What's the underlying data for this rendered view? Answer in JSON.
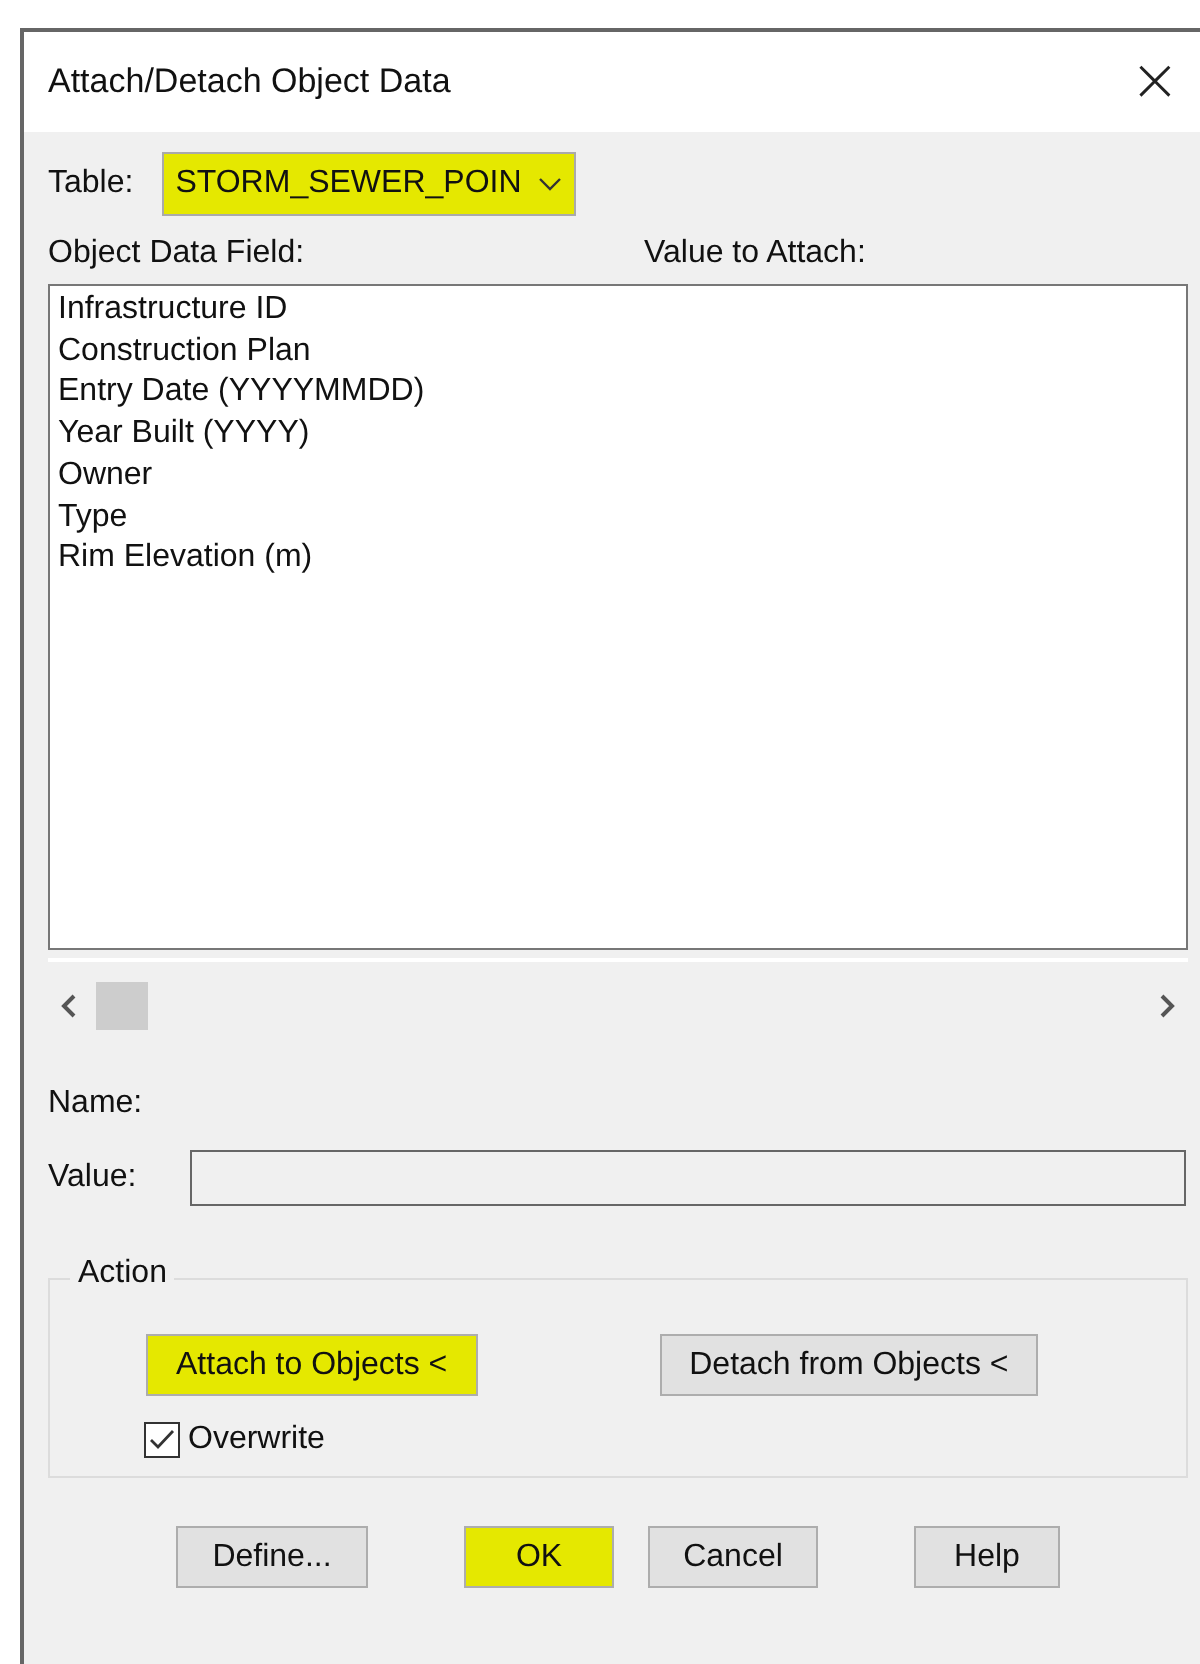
{
  "window": {
    "title": "Attach/Detach Object Data",
    "close": "×"
  },
  "table": {
    "label": "Table:",
    "value": "STORM_SEWER_POIN",
    "highlighted": true
  },
  "columns": [
    "Object Data Field:",
    "Value to Attach:"
  ],
  "fields": [
    "Infrastructure ID",
    "Construction Plan",
    "Entry Date (YYYYMMDD)",
    "Year Built (YYYY)",
    "Owner",
    "Type",
    "Rim Elevation (m)"
  ],
  "name_label": "Name:",
  "value_label": "Value:",
  "action": {
    "title": "Action",
    "buttons": [
      {
        "label": "Attach to Objects <",
        "highlighted": true
      },
      {
        "label": "Detach from Objects <",
        "highlighted": false
      }
    ],
    "overwrite": {
      "label": "Overwrite",
      "checked": true
    }
  },
  "buttons": [
    {
      "label": "Define...",
      "highlighted": false
    },
    {
      "label": "OK",
      "highlighted": true
    },
    {
      "label": "Cancel",
      "highlighted": false
    },
    {
      "label": "Help",
      "highlighted": false
    }
  ]
}
